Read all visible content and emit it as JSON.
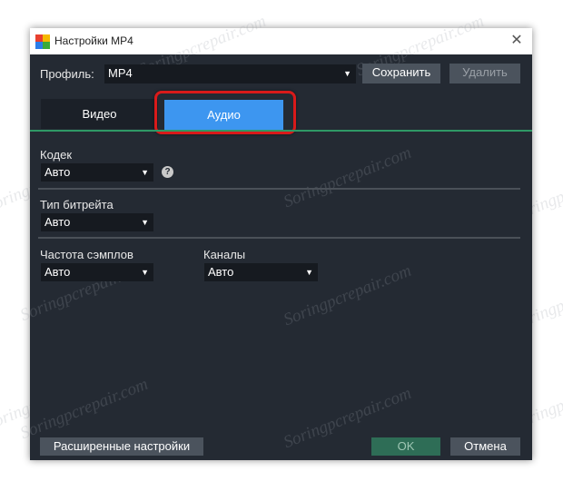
{
  "window": {
    "title": "Настройки MP4",
    "close_glyph": "✕"
  },
  "profile": {
    "label": "Профиль:",
    "value": "MP4",
    "save_label": "Сохранить",
    "delete_label": "Удалить"
  },
  "tabs": [
    {
      "label": "Видео",
      "active": false
    },
    {
      "label": "Аудио",
      "active": true
    }
  ],
  "audio": {
    "codec_label": "Кодек",
    "codec_value": "Авто",
    "bitrate_type_label": "Тип битрейта",
    "bitrate_type_value": "Авто",
    "sample_rate_label": "Частота сэмплов",
    "sample_rate_value": "Авто",
    "channels_label": "Каналы",
    "channels_value": "Авто"
  },
  "footer": {
    "advanced_label": "Расширенные настройки",
    "ok_label": "OK",
    "cancel_label": "Отмена"
  },
  "watermark": "Soringpcrepair.com",
  "colors": {
    "dialog_bg": "#242a33",
    "tab_active": "#3d96f0",
    "accent_line": "#2f9966",
    "ok_button": "#2e6d56",
    "highlight": "#d91a1a"
  }
}
